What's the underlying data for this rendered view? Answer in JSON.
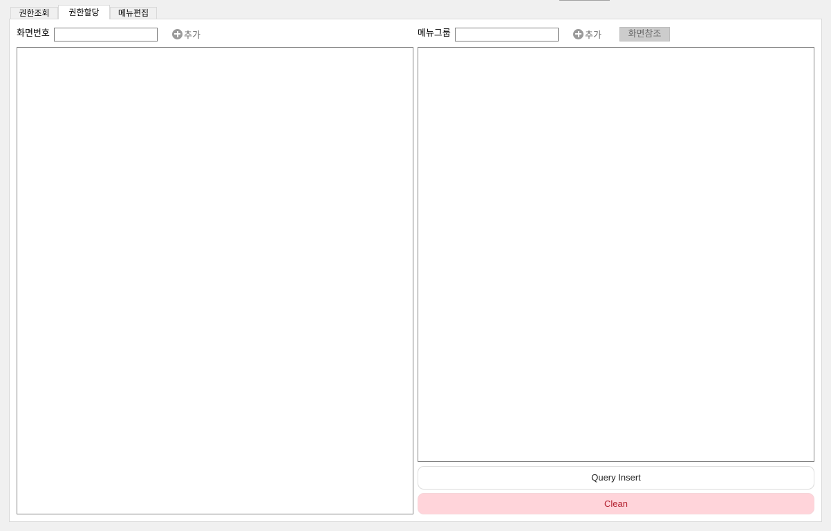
{
  "tabs": [
    {
      "label": "권한조회",
      "active": false
    },
    {
      "label": "권한할당",
      "active": true
    },
    {
      "label": "메뉴편집",
      "active": false
    }
  ],
  "left": {
    "screen_number_label": "화면번호",
    "screen_number_value": "",
    "add_label": "추가"
  },
  "right": {
    "menu_group_label": "메뉴그룹",
    "menu_group_value": "",
    "add_label": "추가",
    "screen_ref_label": "화면참조"
  },
  "actions": {
    "query_insert_label": "Query Insert",
    "clean_label": "Clean"
  },
  "colors": {
    "clean_background": "#ffd4da",
    "clean_text": "#b3202f",
    "disabled_button": "#cccccc",
    "add_icon": "#9a9a9a"
  },
  "icons": {
    "add": "plus-circle-icon"
  }
}
